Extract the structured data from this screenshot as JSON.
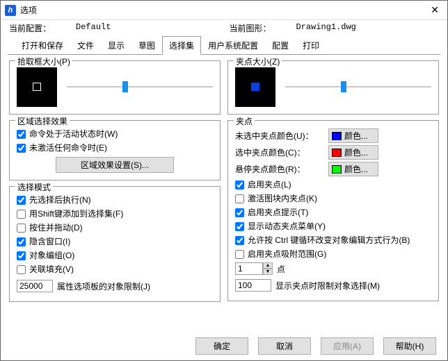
{
  "title": "选项",
  "close_glyph": "✕",
  "info": {
    "cfg_label": "当前配置：",
    "cfg_value": "Default",
    "dwg_label": "当前图形：",
    "dwg_value": "Drawing1.dwg"
  },
  "tabs": {
    "open_save": "打开和保存",
    "file": "文件",
    "display": "显示",
    "sketch": "草图",
    "selection": "选择集",
    "user_sys": "用户系统配置",
    "config": "配置",
    "print": "打印"
  },
  "left": {
    "pickbox_title": "拾取框大小(P)",
    "region_title": "区域选择效果",
    "region_cmd_active": "命令处于活动状态时(W)",
    "region_no_active": "未激活任何命令时(E)",
    "region_settings_btn": "区域效果设置(S)...",
    "mode_title": "选择模式",
    "mode_pre_select": "先选择后执行(N)",
    "mode_shift_add": "用Shift键添加到选择集(F)",
    "mode_press_drag": "按住并拖动(D)",
    "mode_implied_window": "隐含窗口(I)",
    "mode_obj_group": "对象编组(O)",
    "mode_assoc_hatch": "关联填充(V)",
    "limit_value": "25000",
    "limit_label": "属性选项板的对象限制(J)"
  },
  "right": {
    "grip_size_title": "夹点大小(Z)",
    "grip_group_title": "夹点",
    "unselected_label": "未选中夹点颜色(U)：",
    "selected_label": "选中夹点颜色(C)：",
    "hover_label": "悬停夹点颜色(R)：",
    "color_btn": "颜色...",
    "enable_grips": "启用夹点(L)",
    "enable_block_grips": "激活图块内夹点(K)",
    "enable_grip_tips": "启用夹点提示(T)",
    "show_dyn_menu": "显示动态夹点菜单(Y)",
    "allow_ctrl_cycle": "允许按 Ctrl 键循环改变对象编辑方式行为(B)",
    "enable_grip_snap": "启用夹点吸附范围(G)",
    "spin_value": "1",
    "spin_label": "点",
    "obj_limit_value": "100",
    "obj_limit_label": "显示夹点时限制对象选择(M)"
  },
  "footer": {
    "ok": "确定",
    "cancel": "取消",
    "apply": "应用(A)",
    "help": "帮助(H)"
  }
}
